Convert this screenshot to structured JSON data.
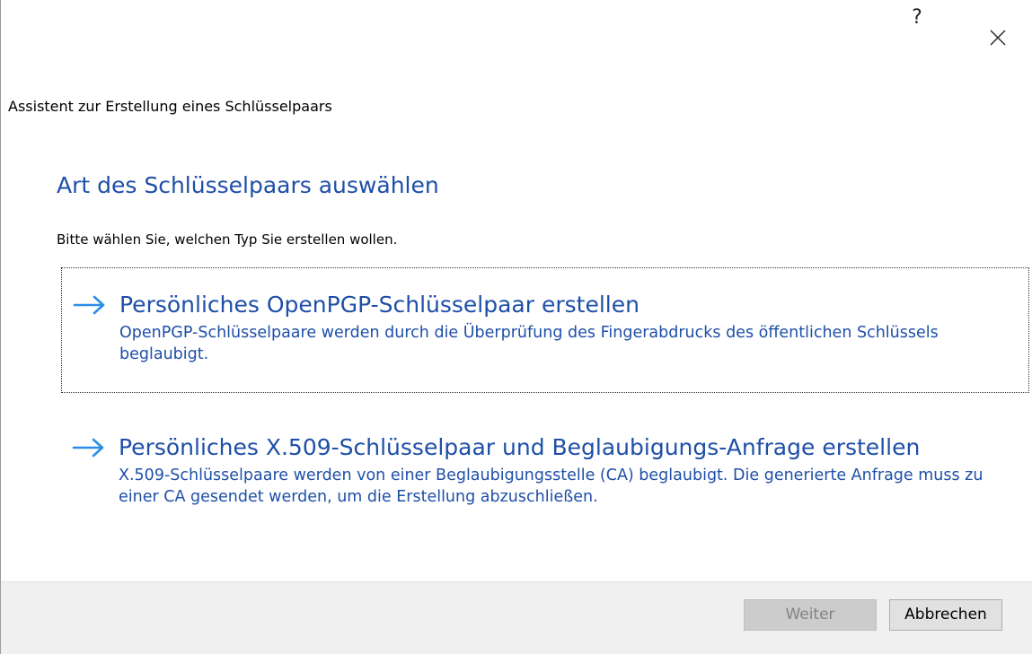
{
  "window": {
    "help_label": "?",
    "close_icon": "close-icon"
  },
  "header": {
    "title": "Assistent zur Erstellung eines Schlüsselpaars"
  },
  "page": {
    "heading": "Art des Schlüsselpaars auswählen",
    "subtitle": "Bitte wählen Sie, welchen Typ Sie erstellen wollen."
  },
  "options": [
    {
      "icon": "arrow-right-icon",
      "title": "Persönliches OpenPGP-Schlüsselpaar erstellen",
      "description": "OpenPGP-Schlüsselpaare werden durch die Überprüfung des Fingerabdrucks des öffentlichen Schlüssels beglaubigt.",
      "focused": true
    },
    {
      "icon": "arrow-right-icon",
      "title": "Persönliches X.509-Schlüsselpaar und Beglaubigungs-Anfrage erstellen",
      "description": "X.509-Schlüsselpaare werden von einer Beglaubigungsstelle (CA) beglaubigt. Die generierte Anfrage muss zu einer CA gesendet werden, um die Erstellung abzuschließen.",
      "focused": false
    }
  ],
  "footer": {
    "next_label": "Weiter",
    "next_enabled": false,
    "cancel_label": "Abbrechen"
  },
  "colors": {
    "accent": "#1e4fa8",
    "arrow": "#2a8ee8",
    "footer_bg": "#f0f0f0"
  }
}
